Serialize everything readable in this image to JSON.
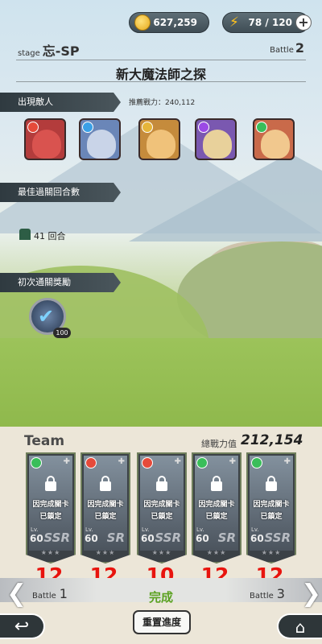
{
  "resources": {
    "gold": "627,259",
    "energy": "78 / 120",
    "plus": "+"
  },
  "stage": {
    "prefix": "stage",
    "name": "忘-SP",
    "battle_label": "Battle",
    "battle_num": "2"
  },
  "title": "新大魔法師之探",
  "sections": {
    "enemies": "出現敵人",
    "recommend": "推薦戰力：240,112",
    "rounds": "最佳過關回合數",
    "rounds_value": "41 回合",
    "reward": "初次通關獎勵",
    "reward_count": "100"
  },
  "enemies": [
    {
      "name": "red-wolf",
      "elem_color": "#e64a3a",
      "bg": "#b33c3c",
      "face": "#d9534f"
    },
    {
      "name": "blue-beast",
      "elem_color": "#3aa0e6",
      "bg": "#6a86b8",
      "face": "#c9d4e8"
    },
    {
      "name": "tiger",
      "elem_color": "#e6b53a",
      "bg": "#c58b3c",
      "face": "#f0c27a"
    },
    {
      "name": "purple-bird",
      "elem_color": "#9b4ae6",
      "bg": "#7a58b0",
      "face": "#e8d19b"
    },
    {
      "name": "blond-hero",
      "elem_color": "#3abe5a",
      "bg": "#c96a4a",
      "face": "#f1c88e"
    }
  ],
  "team": {
    "label": "Team",
    "power_label": "總戰力值",
    "power_value": "212,154",
    "cards": [
      {
        "elem_color": "#3abe5a",
        "lock1": "因完成關卡",
        "lock2": "已鎖定",
        "lv_label": "Lv.",
        "level": "60",
        "rarity": "SSR",
        "stars": "★★★",
        "round": "12"
      },
      {
        "elem_color": "#e64a3a",
        "lock1": "因完成關卡",
        "lock2": "已鎖定",
        "lv_label": "Lv.",
        "level": "60",
        "rarity": "SR",
        "stars": "★★★",
        "round": "12"
      },
      {
        "elem_color": "#e64a3a",
        "lock1": "因完成關卡",
        "lock2": "已鎖定",
        "lv_label": "Lv.",
        "level": "60",
        "rarity": "SSR",
        "stars": "★★★",
        "round": "10"
      },
      {
        "elem_color": "#3abe5a",
        "lock1": "因完成關卡",
        "lock2": "已鎖定",
        "lv_label": "Lv.",
        "level": "60",
        "rarity": "SR",
        "stars": "★★★",
        "round": "12"
      },
      {
        "elem_color": "#3abe5a",
        "lock1": "因完成關卡",
        "lock2": "已鎖定",
        "lv_label": "Lv.",
        "level": "60",
        "rarity": "SSR",
        "stars": "★★★",
        "round": "12"
      }
    ]
  },
  "nav": {
    "left_label": "Battle",
    "left_num": "1",
    "status": "完成",
    "right_label": "Battle",
    "right_num": "3",
    "reset": "重置進度",
    "back_icon": "↩",
    "home_icon": "⌂"
  }
}
